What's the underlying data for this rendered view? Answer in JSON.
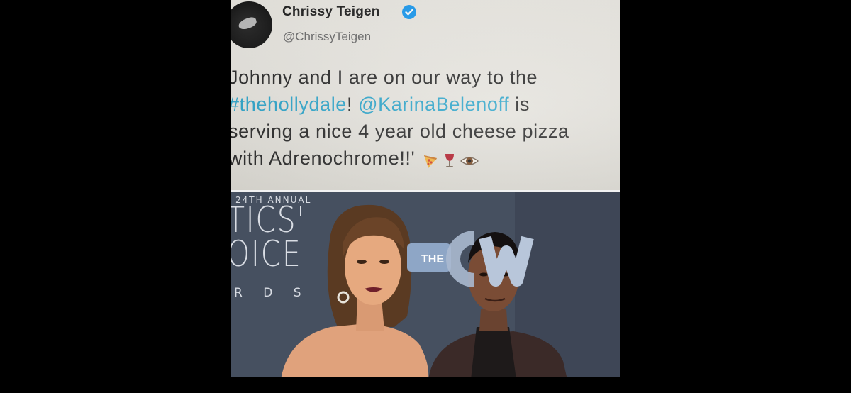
{
  "tweet": {
    "display_name": "Chrissy Teigen",
    "handle": "@ChrissyTeigen",
    "verified": true,
    "avatar_icon": "profile-photo",
    "lines": [
      {
        "text": "Johnny and I are on our way to the"
      },
      {
        "hashtag": "#thehollydale",
        "after_hashtag": "! ",
        "mention": "@KarinaBelenoff",
        "after_mention": " is"
      },
      {
        "text": "serving a nice 4 year old cheese pizza"
      },
      {
        "text": "with Adrenochrome!!'"
      }
    ],
    "emojis": [
      "pizza-emoji",
      "wine-glass-emoji",
      "eye-emoji"
    ],
    "link_color": "#2aa3c9"
  },
  "photo": {
    "backdrop_annual": "24TH ANNUAL",
    "backdrop_line1": "TICS'",
    "backdrop_line2": "OICE",
    "backdrop_line3": "R D S",
    "logo_the": "THE",
    "logo_cw": "CW"
  },
  "colors": {
    "page_background": "#000000",
    "verified_badge": "#1d9bf0",
    "backdrop": "#4c5566"
  }
}
